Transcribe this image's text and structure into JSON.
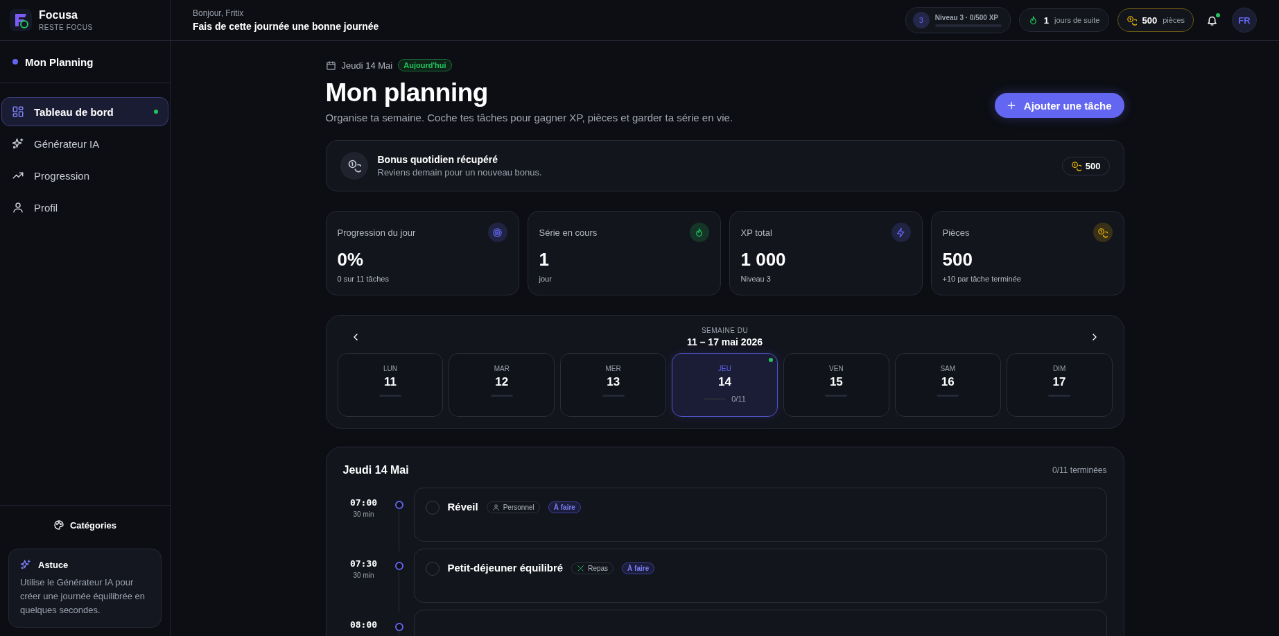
{
  "brand": {
    "name": "Focusa",
    "tagline": "RESTE FOCUS"
  },
  "sidebar": {
    "section": "Mon Planning",
    "items": [
      {
        "label": "Tableau de bord",
        "selected": true
      },
      {
        "label": "Générateur IA",
        "selected": false
      },
      {
        "label": "Progression",
        "selected": false
      },
      {
        "label": "Profil",
        "selected": false
      }
    ],
    "categories_button": "Catégories",
    "tip": {
      "title": "Astuce",
      "text": "Utilise le Générateur IA pour créer une journée équilibrée en quelques secondes."
    }
  },
  "topbar": {
    "greeting": "Bonjour, Fritix",
    "message": "Fais de cette journée une bonne journée",
    "level_badge": "3",
    "level_label": "Niveau 3 · 0/500 XP",
    "streak_value": "1",
    "streak_label": "jours de suite",
    "coins_value": "500",
    "coins_label": "pièces",
    "notification_unread": true,
    "avatar": "FR"
  },
  "header": {
    "date": "Jeudi 14 Mai",
    "today_badge": "Aujourd'hui",
    "title": "Mon planning",
    "subtitle": "Organise ta semaine. Coche tes tâches pour gagner XP, pièces et garder ta série en vie.",
    "add_button": "Ajouter une tâche"
  },
  "bonus": {
    "title": "Bonus quotidien récupéré",
    "text": "Reviens demain pour un nouveau bonus.",
    "amount": "500"
  },
  "stats": [
    {
      "label": "Progression du jour",
      "value": "0%",
      "sub": "0 sur 11 tâches",
      "color": "#6366f1"
    },
    {
      "label": "Série en cours",
      "value": "1",
      "sub": "jour",
      "color": "#22c55e"
    },
    {
      "label": "XP total",
      "value": "1 000",
      "sub": "Niveau 3",
      "color": "#6366f1"
    },
    {
      "label": "Pièces",
      "value": "500",
      "sub": "+10 par tâche terminée",
      "color": "#eab308"
    }
  ],
  "week": {
    "caption": "SEMAINE DU",
    "range": "11 – 17 mai 2026",
    "days": [
      {
        "name": "LUN",
        "number": "11",
        "selected": false,
        "today": false
      },
      {
        "name": "MAR",
        "number": "12",
        "selected": false,
        "today": false
      },
      {
        "name": "MER",
        "number": "13",
        "selected": false,
        "today": false
      },
      {
        "name": "JEU",
        "number": "14",
        "selected": true,
        "today": true,
        "count": "0/11"
      },
      {
        "name": "VEN",
        "number": "15",
        "selected": false,
        "today": false
      },
      {
        "name": "SAM",
        "number": "16",
        "selected": false,
        "today": false
      },
      {
        "name": "DIM",
        "number": "17",
        "selected": false,
        "today": false
      }
    ]
  },
  "tasks": {
    "title": "Jeudi 14 Mai",
    "summary": "0/11 terminées",
    "items": [
      {
        "time": "07:00",
        "duration": "30 min",
        "title": "Réveil",
        "category": "Personnel",
        "status": "À faire",
        "checked": false
      },
      {
        "time": "07:30",
        "duration": "30 min",
        "title": "Petit-déjeuner équilibré",
        "category": "Repas",
        "status": "À faire",
        "checked": false
      },
      {
        "time": "08:00"
      }
    ]
  }
}
